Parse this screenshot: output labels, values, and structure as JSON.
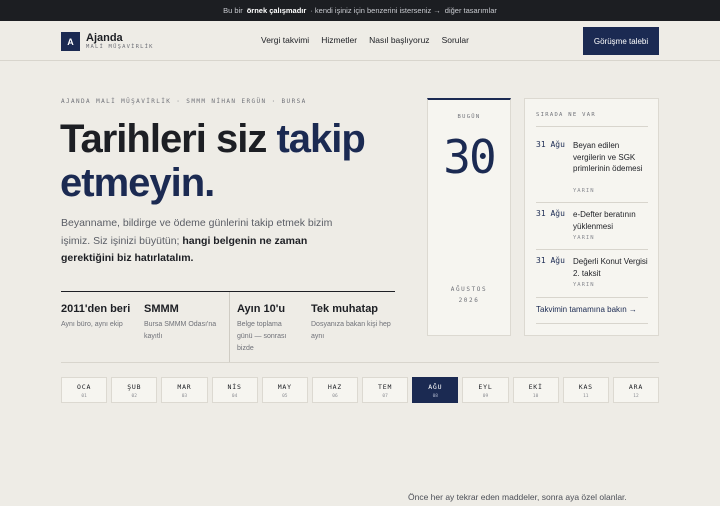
{
  "topbar": {
    "pre": "Bu bir",
    "bold": "örnek çalışmadır",
    "mid": "· kendi işiniz için benzerini isterseniz →",
    "link": "diğer tasarımlar"
  },
  "nav": {
    "logo_letter": "A",
    "brand": "Ajanda",
    "brand_sub": "MALİ MÜŞAVİRLİK",
    "menu": [
      "Vergi takvimi",
      "Hizmetler",
      "Nasıl başlıyoruz",
      "Sorular"
    ],
    "cta": "Görüşme talebi"
  },
  "hero": {
    "eyebrow": "AJANDA MALİ MÜŞAVİRLİK · SMMM NİHAN ERGÜN · BURSA",
    "headline_a": "Tarihleri siz ",
    "headline_b": "takip",
    "headline_c": "etmeyin.",
    "intro_a": "Beyanname, bildirge ve ödeme günlerini takip etmek bizim işimiz. Siz işinizi büyütün; ",
    "intro_b": "hangi belgenin ne zaman gerektiğini biz hatırlatalım."
  },
  "stats": [
    {
      "title": "2011'den beri",
      "desc": "Aynı büro, aynı ekip"
    },
    {
      "title": "SMMM",
      "desc": "Bursa SMMM Odası'na kayıtlı"
    },
    {
      "title": "Ayın 10'u",
      "desc": "Belge toplama günü — sonrası bizde"
    },
    {
      "title": "Tek muhatap",
      "desc": "Dosyanıza bakan kişi hep aynı"
    }
  ],
  "today": {
    "label": "BUGÜN",
    "day": "30",
    "month": "AĞUSTOS",
    "year": "2026"
  },
  "upcoming": {
    "header": "SIRADA NE VAR",
    "items": [
      {
        "date": "31 Ağu",
        "title": "Beyan edilen vergilerin ve SGK primlerinin ödemesi",
        "tag": "YARIN"
      },
      {
        "date": "31 Ağu",
        "title": "e-Defter beratının yüklenmesi",
        "tag": "YARIN"
      },
      {
        "date": "31 Ağu",
        "title": "Değerli Konut Vergisi 2. taksit",
        "tag": "YARIN"
      }
    ],
    "all_link": "Takvimin tamamına bakın →"
  },
  "months": [
    {
      "name": "OCA",
      "idx": "01"
    },
    {
      "name": "ŞUB",
      "idx": "02"
    },
    {
      "name": "MAR",
      "idx": "03"
    },
    {
      "name": "NİS",
      "idx": "04"
    },
    {
      "name": "MAY",
      "idx": "05"
    },
    {
      "name": "HAZ",
      "idx": "06"
    },
    {
      "name": "TEM",
      "idx": "07"
    },
    {
      "name": "AĞU",
      "idx": "08"
    },
    {
      "name": "EYL",
      "idx": "09"
    },
    {
      "name": "EKİ",
      "idx": "10"
    },
    {
      "name": "KAS",
      "idx": "11"
    },
    {
      "name": "ARA",
      "idx": "12"
    }
  ],
  "active_month": "AĞU",
  "footnote": "Önce her ay tekrar eden maddeler, sonra aya özel olanlar.",
  "colors": {
    "accent": "#1b2a52",
    "background": "#eeece6",
    "dark": "#1c1e22"
  }
}
